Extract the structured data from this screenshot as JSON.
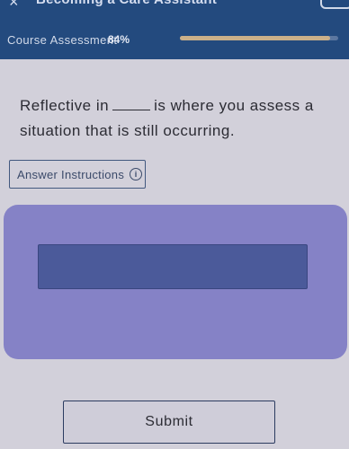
{
  "header": {
    "close_icon": "×",
    "app_title": "Becoming a Care Assistant",
    "assessment_label": "Course Assessment",
    "assessment_percent": "84%",
    "progress_fraction": 0.95
  },
  "question": {
    "text_before": "Reflective in",
    "text_after": "is where you assess a situation that is still occurring."
  },
  "instructions": {
    "label": "Answer Instructions",
    "info_icon": "i"
  },
  "answer": {
    "value": ""
  },
  "submit": {
    "label": "Submit"
  },
  "colors": {
    "header_bg": "#234a7e",
    "panel_bg": "#8582c6",
    "input_bg": "#4b5a9a",
    "progress_fill": "#cbb089"
  }
}
